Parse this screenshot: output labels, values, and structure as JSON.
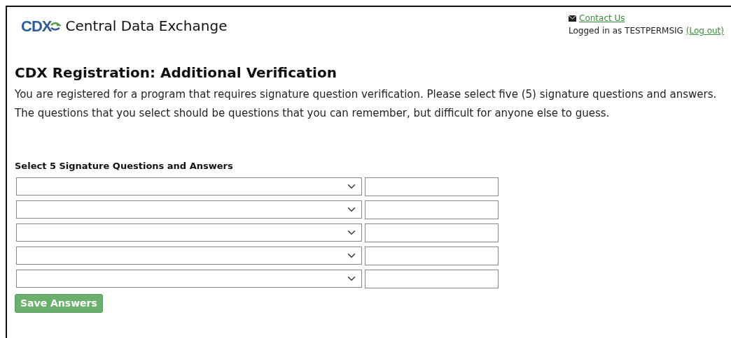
{
  "header": {
    "logo_text": "CDX",
    "site_title": "Central Data Exchange",
    "contact_link": "Contact Us",
    "logged_in_text": "Logged in as TESTPERMSIG",
    "logout_link": "(Log out)"
  },
  "page": {
    "heading": "CDX Registration: Additional Verification",
    "intro": "You are registered for a program that requires signature question verification. Please select five (5) signature questions and answers. The questions that you select should be questions that you can remember, but difficult for anyone else to guess."
  },
  "form": {
    "title": "Select 5 Signature Questions and Answers",
    "rows": [
      {
        "kind": "question-answer"
      },
      {
        "kind": "question-answer"
      },
      {
        "kind": "question-answer"
      },
      {
        "kind": "question-answer"
      },
      {
        "kind": "question-answer"
      }
    ],
    "save_button": "Save Answers"
  }
}
